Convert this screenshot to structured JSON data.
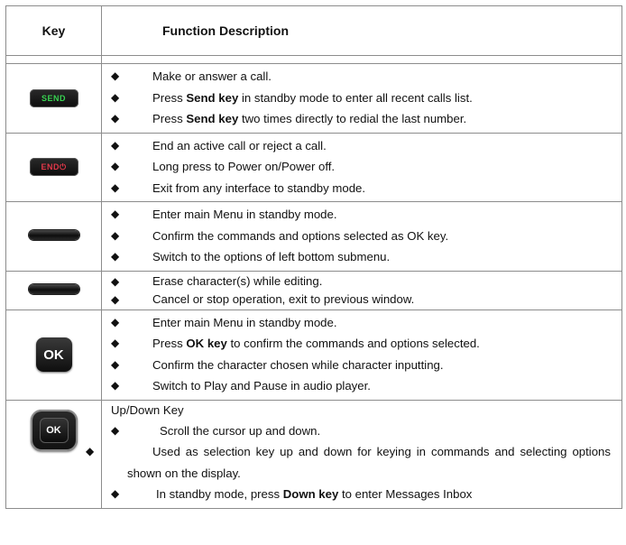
{
  "header": {
    "key": "Key",
    "function": "Function Description"
  },
  "rows": [
    {
      "key_label": "SEND",
      "items": [
        {
          "pre": "Make or answer a call.",
          "bold": "",
          "post": ""
        },
        {
          "pre": "Press ",
          "bold": "Send key",
          "post": " in standby mode to enter all recent calls list."
        },
        {
          "pre": "Press ",
          "bold": "Send key",
          "post": " two times directly to redial the last number."
        }
      ]
    },
    {
      "key_label": "END⏻",
      "items": [
        {
          "pre": "End an active call or reject a call.",
          "bold": "",
          "post": ""
        },
        {
          "pre": "Long press to Power on/Power off.",
          "bold": "",
          "post": ""
        },
        {
          "pre": "Exit from any interface to standby mode.",
          "bold": "",
          "post": ""
        }
      ]
    },
    {
      "key_label": "",
      "items": [
        {
          "pre": "Enter main Menu in standby mode.",
          "bold": "",
          "post": ""
        },
        {
          "pre": "Confirm the commands and options selected as OK key.",
          "bold": "",
          "post": ""
        },
        {
          "pre": "Switch to the options of left bottom submenu.",
          "bold": "",
          "post": ""
        }
      ]
    },
    {
      "key_label": "",
      "items": [
        {
          "pre": "Erase character(s) while editing.",
          "bold": "",
          "post": ""
        },
        {
          "pre": "Cancel or stop operation, exit to previous window.",
          "bold": "",
          "post": ""
        }
      ]
    },
    {
      "key_label": "OK",
      "items": [
        {
          "pre": "Enter main Menu in standby mode.",
          "bold": "",
          "post": ""
        },
        {
          "pre": "Press ",
          "bold": "OK key",
          "post": " to confirm the commands and options selected."
        },
        {
          "pre": "Confirm the character chosen while character inputting.",
          "bold": "",
          "post": ""
        },
        {
          "pre": "Switch to Play and Pause in audio player.",
          "bold": "",
          "post": ""
        }
      ]
    },
    {
      "key_label": "OK",
      "intro": "Up/Down Key",
      "items": [
        {
          "pre": "Scroll the cursor up and down.",
          "bold": "",
          "post": ""
        },
        {
          "pre": "Used as selection key up and down for keying in commands and selecting options shown on the display.",
          "bold": "",
          "post": ""
        },
        {
          "pre": "In standby mode, press ",
          "bold": "Down key",
          "post": " to enter Messages Inbox"
        }
      ]
    }
  ],
  "bullet": "◆"
}
